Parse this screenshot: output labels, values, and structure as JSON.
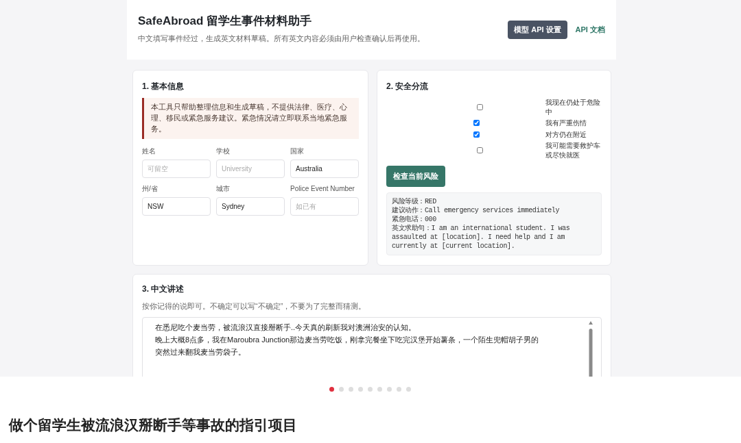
{
  "screenshot": {
    "header": {
      "title": "SafeAbroad 留学生事件材料助手",
      "subtitle": "中文填写事件经过，生成英文材料草稿。所有英文内容必须由用户检查确认后再使用。",
      "actions": [
        {
          "label": "模型 API 设置",
          "kind": "button"
        },
        {
          "label": "API 文档",
          "kind": "link"
        }
      ]
    },
    "basic_info": {
      "title": "1. 基本信息",
      "notice": "本工具只帮助整理信息和生成草稿，不提供法律、医疗、心理、移民或紧急服务建议。紧急情况请立即联系当地紧急服务。",
      "fields": [
        {
          "label": "姓名",
          "placeholder": "可留空"
        },
        {
          "label": "学校",
          "placeholder": "University"
        },
        {
          "label": "国家",
          "value": "Australia"
        },
        {
          "label": "州/省",
          "value": "NSW"
        },
        {
          "label": "城市",
          "value": "Sydney"
        },
        {
          "label": "Police Event Number",
          "placeholder": "如已有"
        }
      ]
    },
    "triage": {
      "title": "2. 安全分流",
      "options": [
        {
          "label": "我现在仍处于危险中",
          "checked": false
        },
        {
          "label": "我有严重伤情",
          "checked": true
        },
        {
          "label": "对方仍在附近",
          "checked": true
        },
        {
          "label": "我可能需要救护车或尽快就医",
          "checked": false
        }
      ],
      "button": "检查当前风险",
      "result_lines": [
        "风险等级：RED",
        "建议动作：Call emergency services immediately",
        "紧急电话：000",
        "英文求助句：I am an international student. I was assaulted at [location]. I need help and I am currently at [current location]."
      ]
    },
    "narrative": {
      "title": "3. 中文讲述",
      "hint": "按你记得的说即可。不确定可以写“不确定”，不要为了完整而猜测。",
      "lines": [
        "在悉尼吃个麦当劳，被流浪汉直接掰断手..今天真的刷新我对澳洲治安的认知。",
        "晚上大概8点多，我在Maroubra Junction那边麦当劳吃饭，刚拿完餐坐下吃完汉堡开始薯条，一个陌生兜帽胡子男的",
        "突然过来翻我麦当劳袋子。"
      ]
    }
  },
  "carousel": {
    "dots": [
      {
        "selected": true
      },
      {
        "selected": false
      },
      {
        "selected": false
      },
      {
        "selected": false
      },
      {
        "selected": false
      },
      {
        "selected": false
      },
      {
        "selected": false
      },
      {
        "selected": false
      },
      {
        "selected": false
      }
    ]
  },
  "post_title": "做个留学生被流浪汉掰断手等事故的指引项目"
}
